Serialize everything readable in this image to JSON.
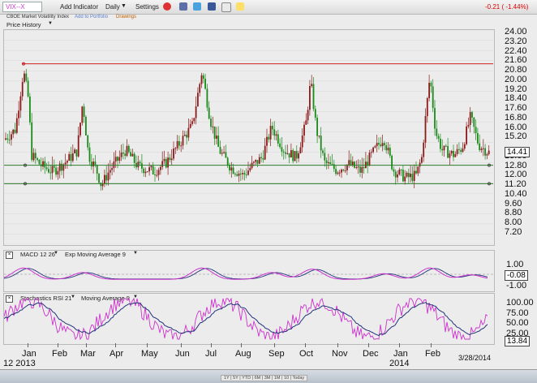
{
  "toolbar": {
    "symbol": "VIX--X",
    "add_indicator": "Add Indicator",
    "interval": "Daily",
    "settings": "Settings",
    "change": "-0.21 ( -1.44%)"
  },
  "subbar": {
    "title": "CBOE Market Volatility Index",
    "add_portfolio": "Add to Portfolio",
    "drawings": "Drawings"
  },
  "price_panel": {
    "label": "Price History",
    "ticks": [
      "24.00",
      "23.20",
      "22.40",
      "21.60",
      "20.80",
      "20.00",
      "19.20",
      "18.40",
      "17.60",
      "16.80",
      "16.00",
      "15.20",
      "14.41",
      "13.60",
      "12.80",
      "12.00",
      "11.20",
      "10.40",
      "9.60",
      "8.80",
      "8.00",
      "7.20"
    ],
    "current_value": "14.41",
    "red_line_level": 21.35,
    "green_line_levels": [
      13.4,
      11.95
    ]
  },
  "macd_panel": {
    "label": "MACD 12 26",
    "signal_label": "Exp Moving Average 9",
    "ticks": [
      "1.00",
      "0.00",
      "-1.00"
    ],
    "current_value": "-0.08"
  },
  "stoch_panel": {
    "label": "Stochastics RSI 21",
    "signal_label": "Moving Average 9",
    "ticks": [
      "100.00",
      "75.00",
      "50.00",
      "25.00",
      "0.00"
    ],
    "current_value": "13.84"
  },
  "x_axis": {
    "months": [
      "Jan",
      "Feb",
      "Mar",
      "Apr",
      "May",
      "Jun",
      "Jul",
      "Aug",
      "Sep",
      "Oct",
      "Nov",
      "Dec",
      "Jan",
      "Feb"
    ],
    "year_left": "12 2013",
    "year_right": "2014",
    "end_date": "3/28/2014"
  },
  "range_bar": "1Y | 5Y | YTD | 6M | 3M | 1M | 10 | Today",
  "colors": {
    "up": "#1a8a1a",
    "down": "#8b1a1a",
    "red_line": "#cc2020",
    "green_line": "#2a7a2a",
    "macd": "#cc33cc",
    "signal": "#22337a"
  },
  "chart_data": {
    "type": "candlestick",
    "title": "CBOE Market Volatility Index",
    "ylim": [
      7.2,
      24.0
    ],
    "monthly_close_approx": {
      "categories": [
        "Jan",
        "Feb",
        "Mar",
        "Apr",
        "May",
        "Jun",
        "Jul",
        "Aug",
        "Sep",
        "Oct",
        "Nov",
        "Dec",
        "Jan",
        "Feb",
        "Mar"
      ],
      "values": [
        13.4,
        14.2,
        12.5,
        13.0,
        13.8,
        16.8,
        13.2,
        13.6,
        15.6,
        14.0,
        12.9,
        13.2,
        13.8,
        15.4,
        14.41
      ]
    }
  }
}
